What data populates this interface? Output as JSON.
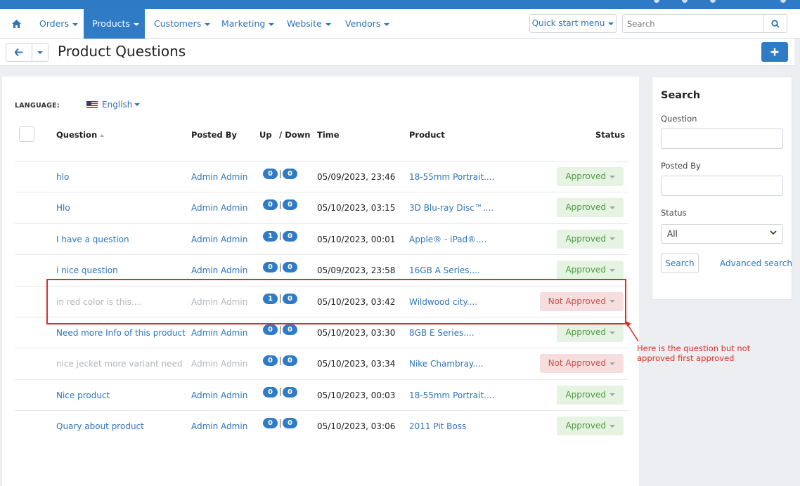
{
  "nav": {
    "home_icon": "home-icon",
    "items": [
      {
        "label": "Orders",
        "active": false
      },
      {
        "label": "Products",
        "active": true
      },
      {
        "label": "Customers",
        "active": false
      },
      {
        "label": "Marketing",
        "active": false
      },
      {
        "label": "Website",
        "active": false
      },
      {
        "label": "Vendors",
        "active": false
      }
    ],
    "quick_start": "Quick start menu",
    "search_placeholder": "Search"
  },
  "titlebar": {
    "title": "Product Questions"
  },
  "language": {
    "label": "LANGUAGE:",
    "value": "English"
  },
  "table": {
    "headers": {
      "question": "Question",
      "posted_by": "Posted By",
      "up": "Up",
      "down": "/ Down",
      "time": "Time",
      "product": "Product",
      "status": "Status"
    },
    "rows": [
      {
        "question": "hlo",
        "posted_by": "Admin Admin",
        "up": "0",
        "down": "0",
        "time": "05/09/2023, 23:46",
        "product": "18-55mm Portrait....",
        "status": "Approved",
        "approved": true
      },
      {
        "question": "Hlo",
        "posted_by": "Admin Admin",
        "up": "0",
        "down": "0",
        "time": "05/10/2023, 03:15",
        "product": "3D Blu-ray Disc™....",
        "status": "Approved",
        "approved": true
      },
      {
        "question": "I have a question",
        "posted_by": "Admin Admin",
        "up": "1",
        "down": "0",
        "time": "05/10/2023, 00:01",
        "product": "Apple® - iPad®....",
        "status": "Approved",
        "approved": true
      },
      {
        "question": "i nice question",
        "posted_by": "Admin Admin",
        "up": "0",
        "down": "0",
        "time": "05/09/2023, 23:58",
        "product": "16GB A Series....",
        "status": "Approved",
        "approved": true
      },
      {
        "question": "in red color is this....",
        "posted_by": "Admin Admin",
        "up": "1",
        "down": "0",
        "time": "05/10/2023, 03:42",
        "product": "Wildwood city....",
        "status": "Not Approved",
        "approved": false
      },
      {
        "question": "Need more Info of this product",
        "posted_by": "Admin Admin",
        "up": "0",
        "down": "0",
        "time": "05/10/2023, 03:30",
        "product": "8GB E Series....",
        "status": "Approved",
        "approved": true
      },
      {
        "question": "nice jecket more variant need",
        "posted_by": "Admin Admin",
        "up": "0",
        "down": "0",
        "time": "05/10/2023, 03:34",
        "product": "Nike Chambray....",
        "status": "Not Approved",
        "approved": false
      },
      {
        "question": "Nice product",
        "posted_by": "Admin Admin",
        "up": "0",
        "down": "0",
        "time": "05/10/2023, 00:03",
        "product": "18-55mm Portrait....",
        "status": "Approved",
        "approved": true
      },
      {
        "question": "Quary about product",
        "posted_by": "Admin Admin",
        "up": "0",
        "down": "0",
        "time": "05/10/2023, 03:06",
        "product": "2011 Pit Boss",
        "status": "Approved",
        "approved": true
      }
    ]
  },
  "annotation": {
    "text": "Here is the question but not approved first approved",
    "color": "#e02c24"
  },
  "sidebar": {
    "title": "Search",
    "question_label": "Question",
    "posted_by_label": "Posted By",
    "status_label": "Status",
    "status_value": "All",
    "search_button": "Search",
    "advanced_link": "Advanced search"
  },
  "colors": {
    "accent": "#2f7bc6",
    "approved_text": "#4c9b3f",
    "not_approved_text": "#c4524e"
  }
}
